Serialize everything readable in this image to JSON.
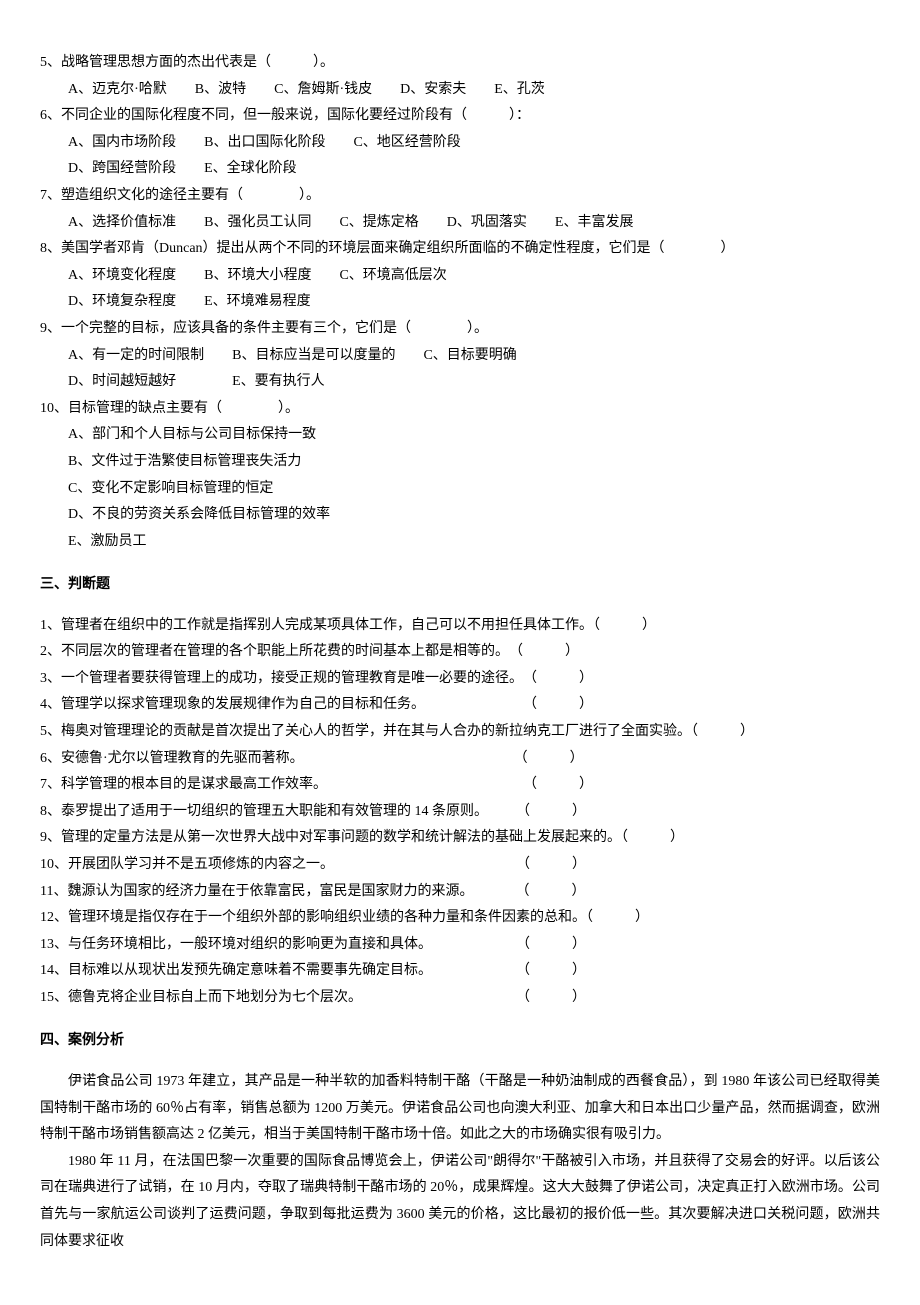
{
  "multiChoice": {
    "q5": {
      "stem": "5、战略管理思想方面的杰出代表是（　　　）。",
      "opts": "A、迈克尔·哈默　　B、波特　　C、詹姆斯·钱皮　　D、安索夫　　E、孔茨"
    },
    "q6": {
      "stem": "6、不同企业的国际化程度不同，但一般来说，国际化要经过阶段有（　　　）：",
      "opts1": "A、国内市场阶段　　B、出口国际化阶段　　C、地区经营阶段",
      "opts2": "D、跨国经营阶段　　E、全球化阶段"
    },
    "q7": {
      "stem": "7、塑造组织文化的途径主要有（　　　　）。",
      "opts": "A、选择价值标准　　B、强化员工认同　　C、提炼定格　　D、巩固落实　　E、丰富发展"
    },
    "q8": {
      "stem": "8、美国学者邓肯（Duncan）提出从两个不同的环境层面来确定组织所面临的不确定性程度，它们是（　　　　）",
      "opts1": "A、环境变化程度　　B、环境大小程度　　C、环境高低层次",
      "opts2": "D、环境复杂程度　　E、环境难易程度"
    },
    "q9": {
      "stem": "9、一个完整的目标，应该具备的条件主要有三个，它们是（　　　　）。",
      "opts1": "A、有一定的时间限制　　B、目标应当是可以度量的　　C、目标要明确",
      "opts2": "D、时间越短越好　　　　E、要有执行人"
    },
    "q10": {
      "stem": "10、目标管理的缺点主要有（　　　　）。",
      "optA": "A、部门和个人目标与公司目标保持一致",
      "optB": "B、文件过于浩繁使目标管理丧失活力",
      "optC": "C、变化不定影响目标管理的恒定",
      "optD": "D、不良的劳资关系会降低目标管理的效率",
      "optE": "E、激励员工"
    }
  },
  "section3": {
    "title": "三、判断题",
    "items": [
      "1、管理者在组织中的工作就是指挥别人完成某项具体工作，自己可以不用担任具体工作。（　　　）",
      "2、不同层次的管理者在管理的各个职能上所花费的时间基本上都是相等的。　（　　　）",
      "3、一个管理者要获得管理上的成功，接受正规的管理教育是唯一必要的途径。　（　　　）",
      "4、管理学以探求管理现象的发展规律作为自己的目标和任务。　　　　　　　　（　　　）",
      "5、梅奥对管理理论的贡献是首次提出了关心人的哲学，并在其与人合办的新拉纳克工厂进行了全面实验。（　　　）",
      "6、安德鲁·尤尔以管理教育的先驱而著称。　　　　　　　　　　　　　　　　（　　　）",
      "7、科学管理的根本目的是谋求最高工作效率。　　　　　　　　　　　　　　　（　　　）",
      "8、泰罗提出了适用于一切组织的管理五大职能和有效管理的 14 条原则。　　　（　　　）",
      "9、管理的定量方法是从第一次世界大战中对军事问题的数学和统计解法的基础上发展起来的。（　　　）",
      "10、开展团队学习并不是五项修炼的内容之一。　　　　　　　　　　　　　　（　　　）",
      "11、魏源认为国家的经济力量在于依靠富民，富民是国家财力的来源。　　　　（　　　）",
      "12、管理环境是指仅存在于一个组织外部的影响组织业绩的各种力量和条件因素的总和。（　　　）",
      "13、与任务环境相比，一般环境对组织的影响更为直接和具体。　　　　　　　（　　　）",
      "14、目标难以从现状出发预先确定意味着不需要事先确定目标。　　　　　　　（　　　）",
      "15、德鲁克将企业目标自上而下地划分为七个层次。　　　　　　　　　　　　（　　　）"
    ]
  },
  "section4": {
    "title": "四、案例分析",
    "p1": "伊诺食品公司 1973 年建立，其产品是一种半软的加香料特制干酪（干酪是一种奶油制成的西餐食品），到 1980 年该公司已经取得美国特制干酪市场的 60％占有率，销售总额为 1200 万美元。伊诺食品公司也向澳大利亚、加拿大和日本出口少量产品，然而据调查，欧洲特制干酪市场销售额高达 2 亿美元，相当于美国特制干酪市场十倍。如此之大的市场确实很有吸引力。",
    "p2": "1980 年 11 月，在法国巴黎一次重要的国际食品博览会上，伊诺公司\"朗得尔\"干酪被引入市场，并且获得了交易会的好评。以后该公司在瑞典进行了试销，在 10 月内，夺取了瑞典特制干酪市场的 20％，成果辉煌。这大大鼓舞了伊诺公司，决定真正打入欧洲市场。公司首先与一家航运公司谈判了运费问题，争取到每批运费为 3600 美元的价格，这比最初的报价低一些。其次要解决进口关税问题，欧洲共同体要求征收"
  }
}
